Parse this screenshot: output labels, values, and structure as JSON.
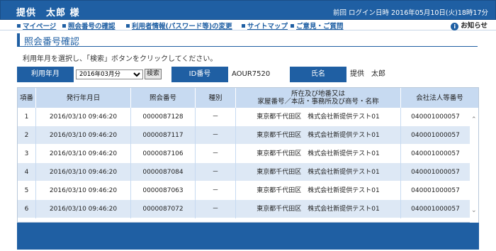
{
  "header": {
    "user_name": "提供　太郎 様",
    "last_login": "前回 ログイン日時 2016年05月10日(火)18時17分"
  },
  "nav": {
    "items": [
      {
        "label": "マイページ"
      },
      {
        "label": "照会番号の確認"
      },
      {
        "label": "利用者情報(パスワード等)の変更"
      },
      {
        "label": "サイトマップ"
      },
      {
        "label": "ご意見・ご質問"
      }
    ],
    "notice_label": "お知らせ"
  },
  "page": {
    "title": "照会番号確認",
    "instruction": "利用年月を選択し、「検索」ボタンをクリックしてください。"
  },
  "filter": {
    "month_label": "利用年月",
    "month_value": "2016年03月分",
    "search_button": "検索",
    "id_label": "ID番号",
    "id_value": "AOUR7520",
    "name_label": "氏名",
    "name_value": "提供　太郎"
  },
  "table": {
    "headers": [
      {
        "label": "項番"
      },
      {
        "label": "発行年月日"
      },
      {
        "label": "照会番号"
      },
      {
        "label": "種別"
      },
      {
        "label": "所在及び地番又は\n家屋番号／本店・事務所及び商号・名称"
      },
      {
        "label": "会社法人等番号"
      }
    ],
    "rows": [
      {
        "no": "1",
        "date": "2016/03/10 09:46:20",
        "inquiry": "0000087128",
        "type": "－",
        "location": "東京都千代田区　株式会社新提供テスト01",
        "corp": "040001000057"
      },
      {
        "no": "2",
        "date": "2016/03/10 09:46:20",
        "inquiry": "0000087117",
        "type": "－",
        "location": "東京都千代田区　株式会社新提供テスト01",
        "corp": "040001000057"
      },
      {
        "no": "3",
        "date": "2016/03/10 09:46:20",
        "inquiry": "0000087106",
        "type": "－",
        "location": "東京都千代田区　株式会社新提供テスト01",
        "corp": "040001000057"
      },
      {
        "no": "4",
        "date": "2016/03/10 09:46:20",
        "inquiry": "0000087084",
        "type": "－",
        "location": "東京都千代田区　株式会社新提供テスト01",
        "corp": "040001000057"
      },
      {
        "no": "5",
        "date": "2016/03/10 09:46:20",
        "inquiry": "0000087063",
        "type": "－",
        "location": "東京都千代田区　株式会社新提供テスト01",
        "corp": "040001000057"
      },
      {
        "no": "6",
        "date": "2016/03/10 09:46:20",
        "inquiry": "0000087072",
        "type": "－",
        "location": "東京都千代田区　株式会社新提供テスト01",
        "corp": "040001000057"
      }
    ]
  },
  "colors": {
    "brand": "#1f5fa3",
    "header_row": "#c7daf1",
    "alt_row": "#dde8f5"
  }
}
